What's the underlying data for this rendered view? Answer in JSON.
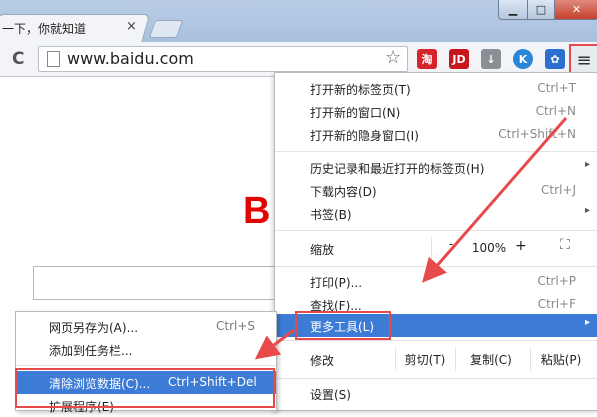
{
  "browser": {
    "tab_title": "一下，你就知道",
    "tab_close": "×",
    "window_buttons": {
      "minimize": "▁",
      "maximize": "□",
      "close": "✕"
    },
    "url": "www.baidu.com",
    "reload_icon": "C",
    "star_icon": "☆",
    "extensions": [
      {
        "name": "taobao-extension-icon",
        "glyph": "淘",
        "color": "#d7232b"
      },
      {
        "name": "jd-extension-icon",
        "glyph": "JD",
        "color": "#c8161d"
      },
      {
        "name": "download-extension-icon",
        "glyph": "↓",
        "color": "#8a8f96"
      },
      {
        "name": "k-extension-icon",
        "glyph": "K",
        "color": "#2a86d6"
      },
      {
        "name": "baidu-paw-extension-icon",
        "glyph": "✿",
        "color": "#2c6fd0"
      }
    ],
    "menu_icon": "≡"
  },
  "page": {
    "logo_fragment": "B"
  },
  "main_menu": {
    "new_tab": {
      "label": "打开新的标签页(T)",
      "shortcut": "Ctrl+T"
    },
    "new_window": {
      "label": "打开新的窗口(N)",
      "shortcut": "Ctrl+N"
    },
    "new_incognito": {
      "label": "打开新的隐身窗口(I)",
      "shortcut": "Ctrl+Shift+N"
    },
    "history": {
      "label": "历史记录和最近打开的标签页(H)",
      "arrow": "▸"
    },
    "downloads": {
      "label": "下载内容(D)",
      "shortcut": "Ctrl+J"
    },
    "bookmarks": {
      "label": "书签(B)",
      "arrow": "▸"
    },
    "zoom": {
      "label": "缩放",
      "minus": "-",
      "value": "100%",
      "plus": "+",
      "fullscreen": "⛶"
    },
    "print": {
      "label": "打印(P)...",
      "shortcut": "Ctrl+P"
    },
    "find": {
      "label": "查找(F)...",
      "shortcut": "Ctrl+F"
    },
    "more_tools": {
      "label": "更多工具(L)",
      "arrow": "▸"
    },
    "edit": {
      "label": "修改",
      "cut": "剪切(T)",
      "copy": "复制(C)",
      "paste": "粘贴(P)"
    },
    "settings": {
      "label": "设置(S)"
    }
  },
  "sub_menu": {
    "save_page": {
      "label": "网页另存为(A)...",
      "shortcut": "Ctrl+S"
    },
    "add_to_taskbar": {
      "label": "添加到任务栏..."
    },
    "clear_data": {
      "label": "清除浏览数据(C)...",
      "shortcut": "Ctrl+Shift+Del"
    },
    "extensions": {
      "label": "扩展程序(E)"
    }
  },
  "colors": {
    "highlight": "#3c7bd6",
    "annotation": "#e64a4a"
  }
}
